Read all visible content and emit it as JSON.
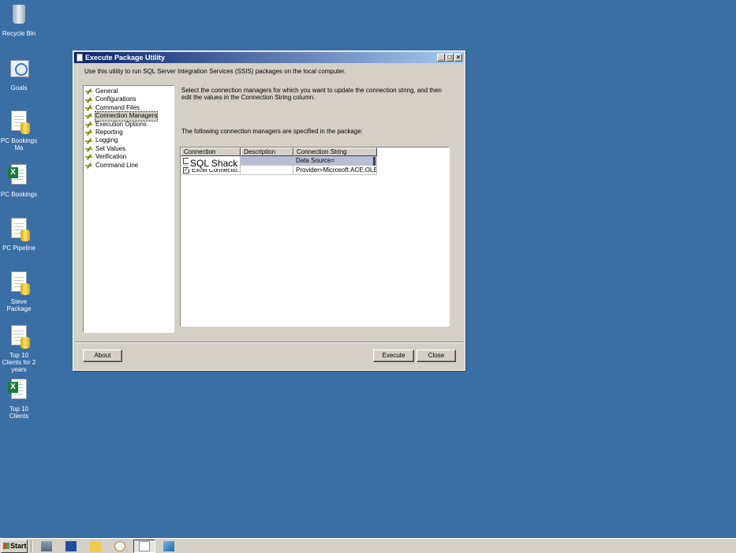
{
  "desktop": {
    "icons": [
      {
        "label": "Recycle Bin",
        "icon": "recycle-bin-icon"
      },
      {
        "label": "Goals",
        "icon": "goals-icon"
      },
      {
        "label": "PC Bookings Ma",
        "icon": "package-icon"
      },
      {
        "label": "PC Bookings",
        "icon": "excel-icon"
      },
      {
        "label": "PC Pipeline",
        "icon": "package-icon"
      },
      {
        "label": "Steve Package",
        "icon": "package-icon"
      },
      {
        "label": "Top 10 Clients for 2 years",
        "icon": "package-icon"
      },
      {
        "label": "Top 10 Clients",
        "icon": "excel-icon"
      }
    ]
  },
  "window": {
    "title": "Execute Package Utility",
    "intro": "Use this utility to run SQL Server Integration Services (SSIS) packages on the local computer.",
    "nav": [
      {
        "label": "General"
      },
      {
        "label": "Configurations"
      },
      {
        "label": "Command Files"
      },
      {
        "label": "Connection Managers",
        "selected": true
      },
      {
        "label": "Execution Options"
      },
      {
        "label": "Reporting"
      },
      {
        "label": "Logging"
      },
      {
        "label": "Set Values"
      },
      {
        "label": "Verification"
      },
      {
        "label": "Command Line"
      }
    ],
    "description": "Select the connection managers for which you want to update the connection string, and then edit the values in the Connection String column.",
    "grid_caption": "The following connection managers are specified in the package:",
    "grid": {
      "columns": [
        "Connection Manager",
        "Description",
        "Connection String"
      ],
      "rows": [
        {
          "checked": false,
          "manager": "",
          "description": "",
          "connection_string": "Data Source="
        },
        {
          "checked": true,
          "manager": "Excel Connectio...",
          "description": "",
          "connection_string": "Provider=Microsoft.ACE.OLE..."
        }
      ]
    },
    "overlay_label": "SQL Shack",
    "buttons": {
      "about": "About",
      "execute": "Execute",
      "close": "Close"
    }
  },
  "taskbar": {
    "start_label": "Start"
  }
}
